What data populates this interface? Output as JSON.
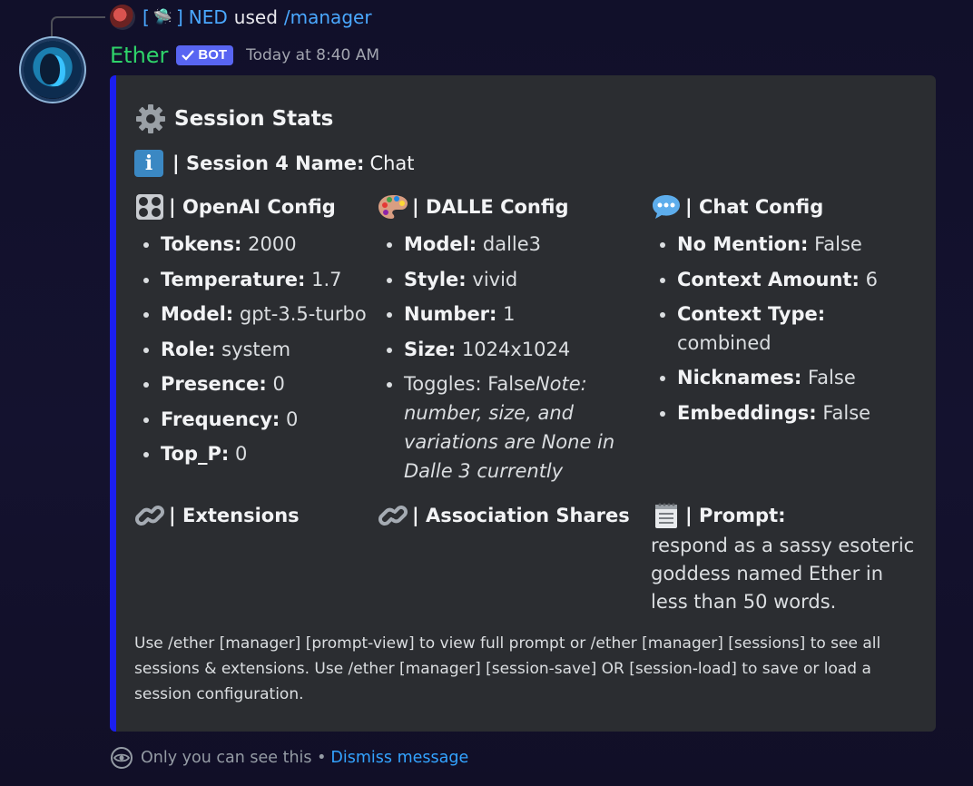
{
  "reply": {
    "bracket_open": "[",
    "ufo_emoji": "🛸",
    "bracket_close": "]",
    "username": "NED",
    "used_text": "used",
    "command": "/manager"
  },
  "message": {
    "author": "Ether",
    "bot_tag": "BOT",
    "timestamp": "Today at 8:40 AM"
  },
  "embed": {
    "accent_color": "#1b1ef0",
    "title": "Session Stats",
    "session_prefix": "| Session 4 Name:",
    "session_name": "Chat",
    "fields": {
      "openai": {
        "title": "| OpenAI Config",
        "icon": "control-knobs-icon",
        "items": [
          {
            "key": "Tokens:",
            "value": "2000"
          },
          {
            "key": "Temperature:",
            "value": "1.7"
          },
          {
            "key": "Model:",
            "value": "gpt-3.5-turbo"
          },
          {
            "key": "Role:",
            "value": "system"
          },
          {
            "key": "Presence:",
            "value": "0"
          },
          {
            "key": "Frequency:",
            "value": "0"
          },
          {
            "key": "Top_P:",
            "value": "0"
          }
        ]
      },
      "dalle": {
        "title": "| DALLE Config",
        "icon": "palette-icon",
        "items": [
          {
            "key": "Model:",
            "value": "dalle3"
          },
          {
            "key": "Style:",
            "value": "vivid"
          },
          {
            "key": "Number:",
            "value": "1"
          },
          {
            "key": "Size:",
            "value": "1024x1024"
          }
        ],
        "toggles_text": "Toggles: False",
        "toggles_note": "Note: number, size, and variations are None in Dalle 3 currently"
      },
      "chat": {
        "title": "| Chat Config",
        "icon": "speech-bubble-icon",
        "items": [
          {
            "key": "No Mention:",
            "value": "False"
          },
          {
            "key": "Context Amount:",
            "value": "6"
          },
          {
            "key": "Context Type:",
            "value": "combined"
          },
          {
            "key": "Nicknames:",
            "value": "False"
          },
          {
            "key": "Embeddings:",
            "value": "False"
          }
        ]
      },
      "extensions": {
        "title": "| Extensions",
        "icon": "link-icon"
      },
      "association": {
        "title": "| Association Shares",
        "icon": "link-icon"
      },
      "prompt": {
        "title": "| Prompt:",
        "icon": "notepad-icon",
        "value": "respond as a sassy esoteric goddess named Ether in less than 50 words."
      }
    },
    "footer_note": "Use /ether [manager] [prompt-view] to view full prompt or /ether [manager] [sessions] to see all sessions & extensions. Use /ether [manager] [session-save] OR [session-load] to save or load a session configuration."
  },
  "ephemeral": {
    "text": "Only you can see this •",
    "dismiss": "Dismiss message"
  }
}
